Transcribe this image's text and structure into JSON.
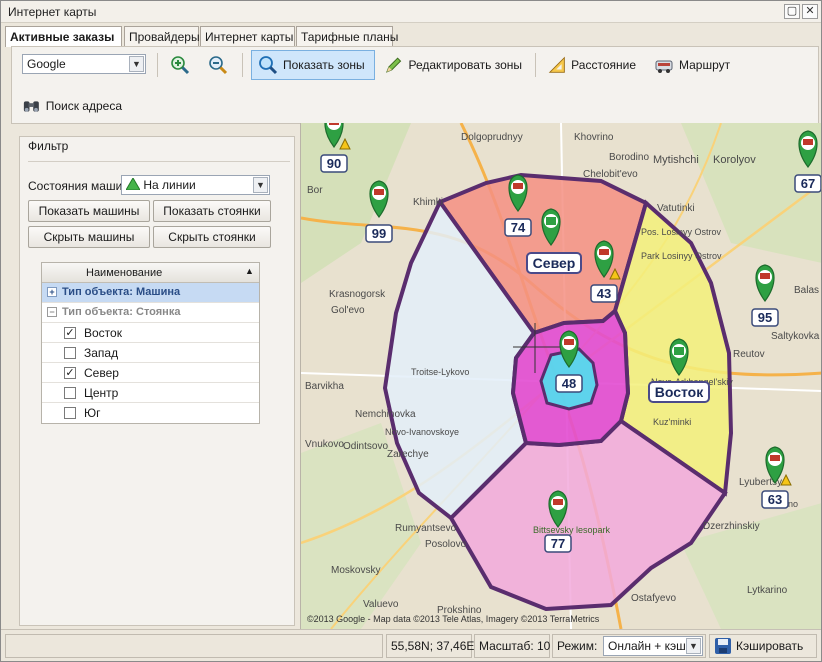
{
  "window": {
    "title": "Интернет карты"
  },
  "tabs": [
    "Активные заказы",
    "Провайдеры",
    "Интернет карты",
    "Тарифные планы"
  ],
  "toolbar": {
    "provider_value": "Google",
    "show_zones": "Показать зоны",
    "edit_zones": "Редактировать зоны",
    "distance": "Расстояние",
    "route": "Маршрут",
    "address_search": "Поиск адреса"
  },
  "filter": {
    "title": "Фильтр",
    "state_label": "Состояния машин",
    "state_value": "На линии",
    "btn_show_cars": "Показать машины",
    "btn_show_stands": "Показать стоянки",
    "btn_hide_cars": "Скрыть машины",
    "btn_hide_stands": "Скрыть стоянки",
    "grid": {
      "column": "Наименование",
      "group_cars": "Тип объекта:  Машина",
      "group_stands": "Тип объекта:  Стоянка",
      "rows": [
        {
          "name": "Восток",
          "checked": true
        },
        {
          "name": "Запад",
          "checked": false
        },
        {
          "name": "Север",
          "checked": true
        },
        {
          "name": "Центр",
          "checked": false
        },
        {
          "name": "Юг",
          "checked": false
        }
      ]
    }
  },
  "map": {
    "zone_labels": {
      "north": "Север",
      "east": "Восток"
    },
    "markers": [
      "90",
      "99",
      "74",
      "43",
      "48",
      "77",
      "95",
      "67",
      "63"
    ],
    "places": [
      "Dolgoprudnyy",
      "Khovrino",
      "Mytishchi",
      "Korolyov",
      "Khimki",
      "Borodino",
      "Bor",
      "Chelobit'evo",
      "Vatutinki",
      "Pos. Losinyy Ostrov",
      "Park Losinyy Ostrov",
      "Krasnogorsk",
      "Gol'evo",
      "Balas",
      "Reutov",
      "Saltykovka",
      "Barvikha",
      "Nemchinovka",
      "Vnukovo",
      "Odintsovo",
      "Zarechye",
      "Rumyantsevo",
      "Posolovo",
      "Moskovsky",
      "Valuevo",
      "Prokshino",
      "Lyubertsy",
      "Dzerzhinskiy",
      "Lytkarino",
      "Bittsevsky lesopark",
      "Ostafyevo",
      "Troitse-Lykovo",
      "Novo-Arkhangel'skiy",
      "Novo-Ivanovskoye",
      "Kuz'minki",
      "Tomilino"
    ],
    "copyright": "©2013 Google - Map data ©2013 Tele Atlas, Imagery ©2013 TerraMetrics"
  },
  "statusbar": {
    "coords": "55,58N; 37,46E",
    "scale": "Масштаб: 10",
    "mode_label": "Режим:",
    "mode_value": "Онлайн + кэш",
    "cache_button": "Кэшировать"
  },
  "colors": {
    "zone_north": "#f58f83",
    "zone_east": "#f3f07a",
    "zone_south": "#f2a9dc",
    "zone_west": "#e3eef9",
    "zone_center": "#e24bd2",
    "zone_core": "#4fe0ee",
    "zone_border": "#5a2d6e",
    "marker_green": "#2ea043",
    "active_tab": "#ffffff"
  }
}
